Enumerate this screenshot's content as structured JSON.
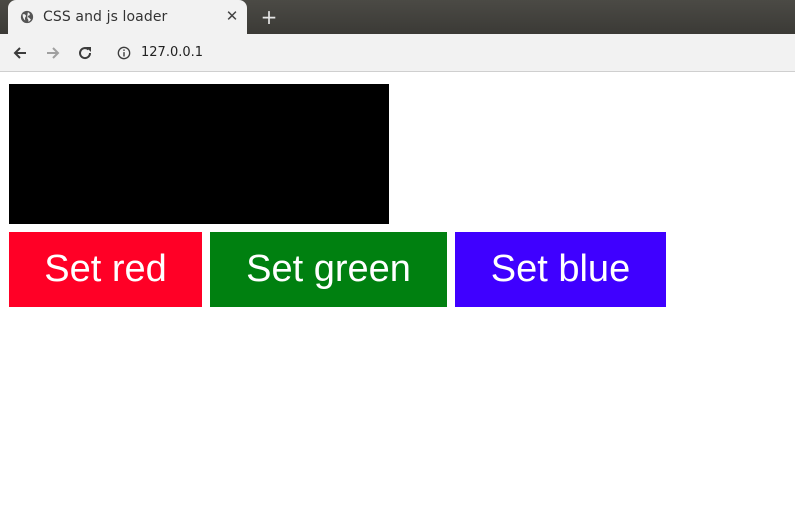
{
  "browser": {
    "tab": {
      "title": "CSS and js loader",
      "favicon": "globe-icon",
      "close_icon": "close-icon"
    },
    "new_tab_icon": "plus-icon",
    "toolbar": {
      "back_icon": "arrow-left-icon",
      "forward_icon": "arrow-right-icon",
      "reload_icon": "reload-icon",
      "info_icon": "info-icon",
      "url": "127.0.0.1"
    }
  },
  "page": {
    "display_box_color": "#000000",
    "buttons": [
      {
        "label": "Set red",
        "color": "#ff0026"
      },
      {
        "label": "Set green",
        "color": "#008010"
      },
      {
        "label": "Set blue",
        "color": "#3f00ff"
      }
    ]
  }
}
